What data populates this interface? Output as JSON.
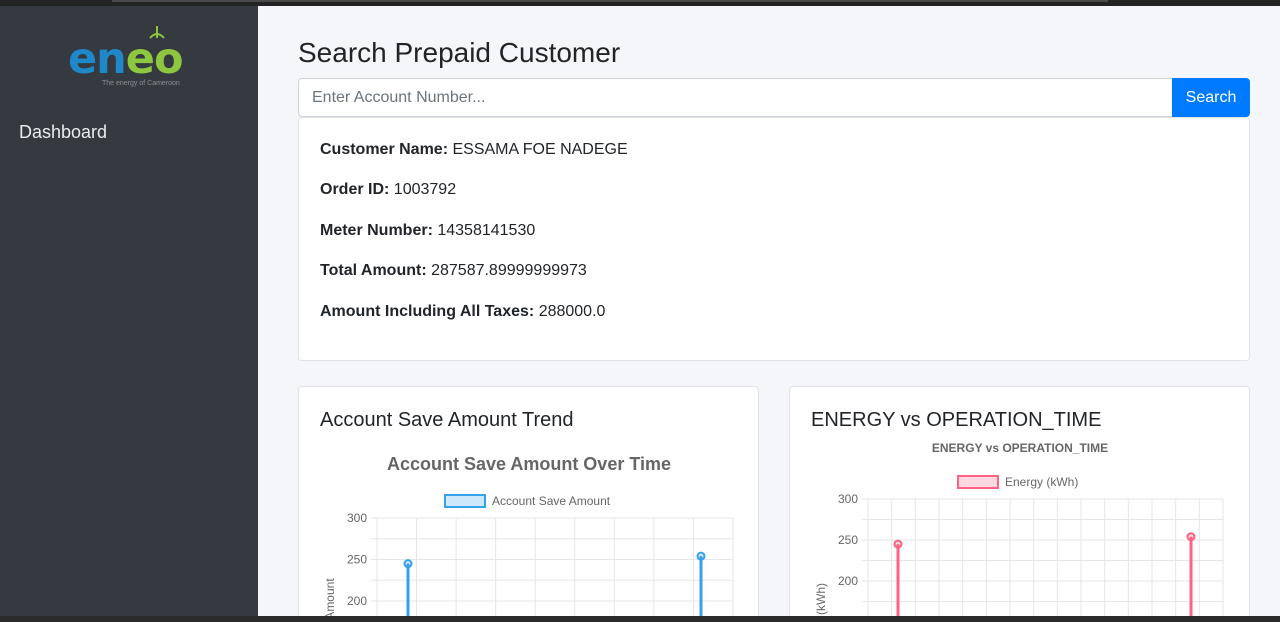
{
  "sidebar": {
    "logo": {
      "text": "eneo",
      "tagline": "The energy of Cameroon"
    },
    "items": [
      {
        "label": "Dashboard"
      }
    ]
  },
  "main": {
    "title": "Search Prepaid Customer",
    "search": {
      "placeholder": "Enter Account Number...",
      "button_label": "Search"
    },
    "customer": {
      "name_label": "Customer Name:",
      "name_value": "ESSAMA FOE NADEGE",
      "order_label": "Order ID:",
      "order_value": "1003792",
      "meter_label": "Meter Number:",
      "meter_value": "14358141530",
      "total_label": "Total Amount:",
      "total_value": "287587.89999999973",
      "taxes_label": "Amount Including All Taxes:",
      "taxes_value": "288000.0"
    },
    "cards": [
      {
        "title": "Account Save Amount Trend"
      },
      {
        "title": "ENERGY vs OPERATION_TIME"
      }
    ]
  },
  "colors": {
    "sidebar": "#343a40",
    "accent": "#007bff",
    "series_blue": "#36a2eb",
    "series_pink": "#ff6384"
  },
  "chart_data": [
    {
      "type": "line",
      "title": "Account Save Amount Over Time",
      "ylabel": "Amount",
      "legend": "top",
      "series": [
        {
          "name": "Account Save Amount"
        }
      ],
      "y_ticks": [
        300,
        250,
        200
      ],
      "ylim": [
        200,
        300
      ],
      "grid": true,
      "visible_peaks": [
        245,
        254
      ]
    },
    {
      "type": "line",
      "title": "ENERGY vs OPERATION_TIME",
      "ylabel": "(kWh)",
      "legend": "top",
      "series": [
        {
          "name": "Energy (kWh)"
        }
      ],
      "y_ticks": [
        300,
        250,
        200
      ],
      "ylim": [
        150,
        300
      ],
      "grid": true,
      "visible_peaks": [
        245,
        254
      ]
    }
  ]
}
